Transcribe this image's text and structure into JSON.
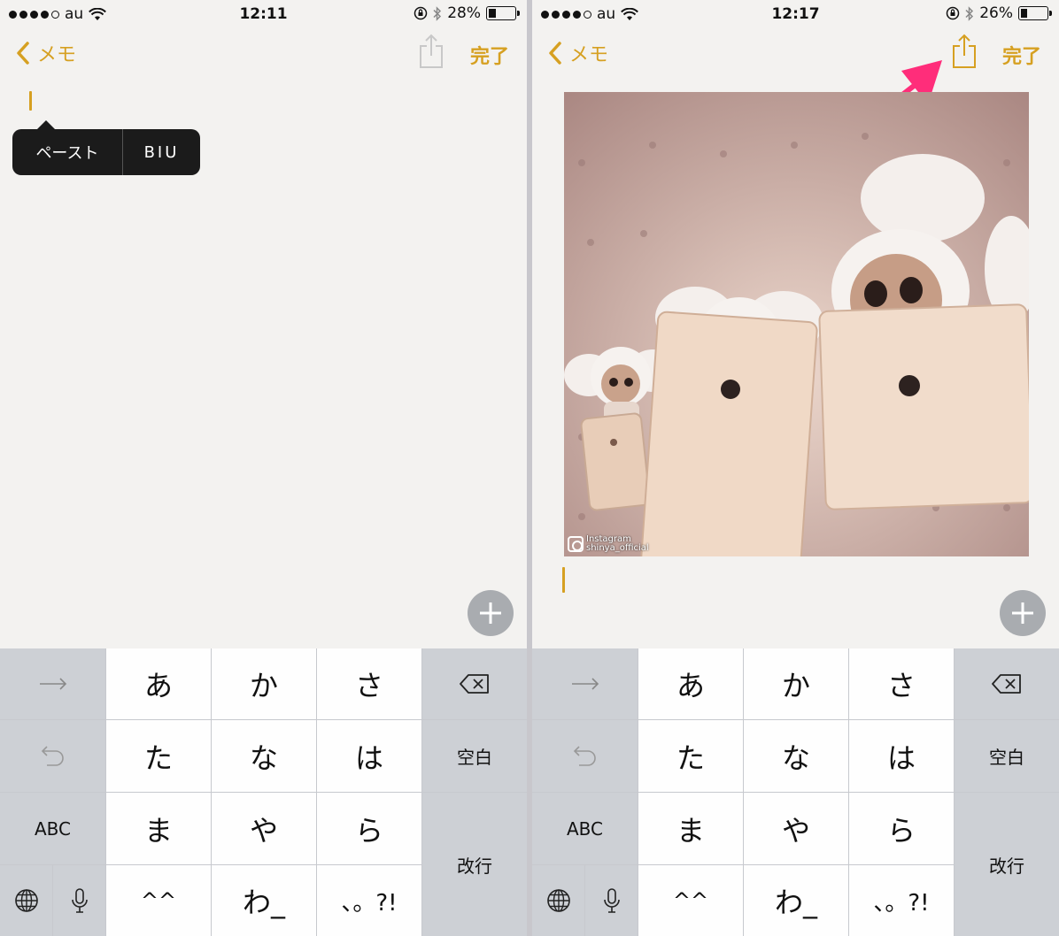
{
  "left": {
    "status": {
      "carrier": "au",
      "time": "12:11",
      "battery": "28%",
      "battery_level": 0.28
    },
    "nav": {
      "back_label": "メモ",
      "done_label": "完了"
    },
    "edit_menu": {
      "paste": "ペースト",
      "format": "BIU"
    }
  },
  "right": {
    "status": {
      "carrier": "au",
      "time": "12:17",
      "battery": "26%",
      "battery_level": 0.26
    },
    "nav": {
      "back_label": "メモ",
      "done_label": "完了"
    },
    "photo": {
      "caption_line1": "Instagram",
      "caption_line2": "shinya_official"
    }
  },
  "keyboard": {
    "rows": [
      {
        "left": "→",
        "keys": [
          "あ",
          "か",
          "さ"
        ],
        "right": "delete"
      },
      {
        "left": "undo",
        "keys": [
          "た",
          "な",
          "は"
        ],
        "right": "空白"
      },
      {
        "left": "ABC",
        "keys": [
          "ま",
          "や",
          "ら"
        ],
        "right": "改行"
      },
      {
        "left": "globe/mic",
        "keys": [
          "^^",
          "わ_",
          "、。?!"
        ]
      }
    ]
  },
  "colors": {
    "accent": "#d6a021",
    "annotation_arrow": "#ff2d7a"
  },
  "icons": [
    "chevron-left-icon",
    "share-icon",
    "plus-icon",
    "delete-icon",
    "undo-icon",
    "globe-icon",
    "mic-icon",
    "wifi-icon",
    "lock-rotation-icon",
    "bluetooth-icon",
    "battery-icon"
  ]
}
